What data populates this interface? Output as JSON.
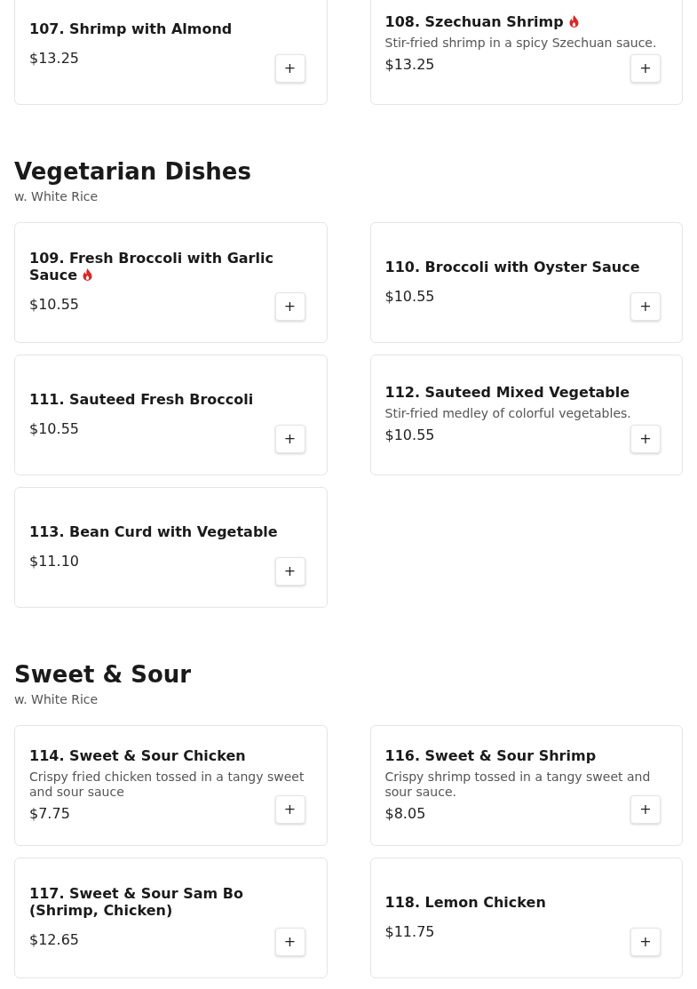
{
  "sections": [
    {
      "items": [
        {
          "name": "107. Shrimp with Almond",
          "spicy": false,
          "price": "$13.25",
          "button": "+"
        },
        {
          "name": "108. Szechuan Shrimp",
          "spicy": true,
          "description": "Stir-fried shrimp in a spicy Szechuan sauce.",
          "price": "$13.25",
          "button": "+"
        }
      ]
    },
    {
      "title": "Vegetarian Dishes",
      "subtitle": "w. White Rice",
      "items": [
        {
          "name": "109. Fresh Broccoli with Garlic Sauce",
          "spicy": true,
          "price": "$10.55",
          "button": "+"
        },
        {
          "name": "110. Broccoli with Oyster Sauce",
          "spicy": false,
          "price": "$10.55",
          "button": "+"
        },
        {
          "name": "111. Sauteed Fresh Broccoli",
          "spicy": false,
          "price": "$10.55",
          "button": "+"
        },
        {
          "name": "112. Sauteed Mixed Vegetable",
          "spicy": false,
          "description": "Stir-fried medley of colorful vegetables.",
          "price": "$10.55",
          "button": "+"
        },
        {
          "name": "113. Bean Curd with Vegetable",
          "spicy": false,
          "price": "$11.10",
          "button": "+"
        }
      ]
    },
    {
      "title": "Sweet & Sour",
      "subtitle": "w. White Rice",
      "items": [
        {
          "name": "114. Sweet & Sour Chicken",
          "spicy": false,
          "description": "Crispy fried chicken tossed in a tangy sweet and sour sauce",
          "price": "$7.75",
          "button": "+"
        },
        {
          "name": "116. Sweet & Sour Shrimp",
          "spicy": false,
          "description": "Crispy shrimp tossed in a tangy sweet and sour sauce.",
          "price": "$8.05",
          "button": "+"
        },
        {
          "name": "117. Sweet & Sour Sam Bo (Shrimp, Chicken)",
          "spicy": false,
          "price": "$12.65",
          "button": "+"
        },
        {
          "name": "118. Lemon Chicken",
          "spicy": false,
          "price": "$11.75",
          "button": "+"
        }
      ]
    }
  ]
}
